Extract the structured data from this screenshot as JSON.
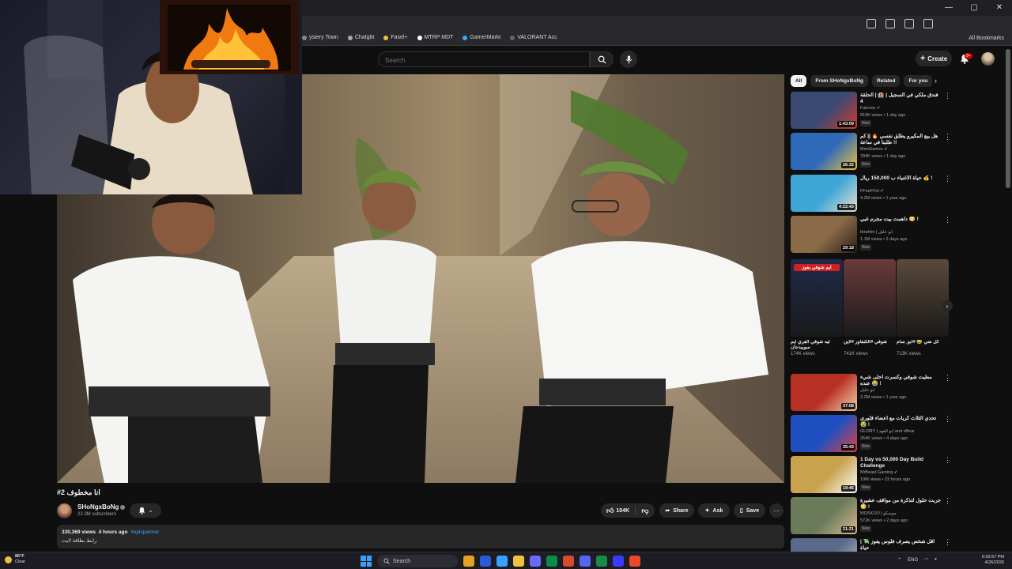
{
  "browser": {
    "window_controls": [
      "—",
      "▢",
      "✕"
    ],
    "bookmarks": [
      {
        "label": "ystery Town",
        "color": "#888888"
      },
      {
        "label": "Chatgbt",
        "color": "#aaaaaa"
      },
      {
        "label": "Fasel+",
        "color": "#f0c040"
      },
      {
        "label": "MTRP MDT",
        "color": "#ffffff"
      },
      {
        "label": "GamerMarkt",
        "color": "#3ea6ff"
      },
      {
        "label": "VALORANT Acc",
        "color": "#666666"
      }
    ],
    "all_bookmarks": "All Bookmarks"
  },
  "header": {
    "search_placeholder": "Search",
    "create_label": "Create",
    "notification_badge": "9+"
  },
  "video": {
    "title": "#2 انا مخطوف",
    "channel": "SHoNgxBoNg",
    "subscribers": "22.3M subscribers",
    "likes": "104K",
    "share_label": "Share",
    "ask_label": "Ask",
    "save_label": "Save",
    "views": "330,369 views",
    "age": "4 hours ago",
    "hashtag": "#epicpartner",
    "desc_line": "رابط بطاقة لايت"
  },
  "sidebar": {
    "chips": [
      "All",
      "From SHoNgxBoNg",
      "Related",
      "For you"
    ],
    "recs": [
      {
        "title": "فندق ملكي في السجيل | 🏨 | الحلقة 4",
        "channel": "Falcons ✔",
        "views": "815K views • 1 day ago",
        "badge": "New",
        "duration": "1:43:09",
        "thumb_color": "#3a4a72",
        "accent": "#d33a2a"
      },
      {
        "title": "هل يبع المكيرو يطلق نفسي 🔥 || كم طلبنا في ساعة !!",
        "channel": "MrmGames ✔",
        "views": "784K views • 1 day ago",
        "badge": "New",
        "duration": "26:32",
        "thumb_color": "#2e6ab8",
        "accent": "#f0c040"
      },
      {
        "title": "حياة الأغنياء ب 150,000 ريال 💰 !",
        "channel": "FFeeFFol ✔",
        "views": "4.2M views • 1 year ago",
        "badge": "",
        "duration": "4:22:43",
        "thumb_color": "#3fa6d8",
        "accent": "#e8e0d0"
      },
      {
        "title": "داهمت بيت مجرم غبي 😳 !",
        "channel": "Ibrahim | ابو خليل",
        "views": "1.1M views • 2 days ago",
        "badge": "New",
        "duration": "29:18",
        "thumb_color": "#8a6a48",
        "accent": "#2a1e16"
      },
      {
        "title": "مطيت شوفي وكسرت احلى شيء عنده 😭 !",
        "channel": "ابو خليل",
        "views": "3.2M views • 1 year ago",
        "badge": "",
        "duration": "37:08",
        "thumb_color": "#b83024",
        "accent": "#f0d0b0"
      },
      {
        "title": "تحدي الثلاث كريات مع اعضاء قلوري 😭 !",
        "channel": "GLORY | أبو الفهد and xBear",
        "views": "264K views • 4 days ago",
        "badge": "New",
        "duration": "35:43",
        "thumb_color": "#2050c0",
        "accent": "#e04040"
      },
      {
        "title": "1 Day vs 50,000 Day Build Challenge",
        "channel": "MrBeast Gaming ✔",
        "views": "10M views • 23 hours ago",
        "badge": "New",
        "duration": "19:46",
        "thumb_color": "#c8a24c",
        "accent": "#ffffff"
      },
      {
        "title": "جربت حلول لتذكرة من مواقف عشيرة 😳 !",
        "channel": "MOSKOO | موسكو",
        "views": "572K views • 2 days ago",
        "badge": "New",
        "duration": "21:21",
        "thumb_color": "#6a7a5a",
        "accent": "#d8b890"
      },
      {
        "title": "اقل شخص يصرف فلوس يفوز 💸 | حياة",
        "channel": "",
        "views": "",
        "badge": "",
        "duration": "",
        "thumb_color": "#5a6a8a",
        "accent": "#c8c8c8"
      }
    ],
    "shorts": [
      {
        "title": "ليه شوفي الفري ايم سوبيدجان",
        "views": "174K views",
        "thumb_color": "#1e2a4a",
        "label": "ايم شوفي يفوز"
      },
      {
        "title": "شوفي #الكنفاور #لاين",
        "views": "741K views",
        "thumb_color": "#6a3a3a",
        "label": ""
      },
      {
        "title": "كل ضي 😂 #ابو_سام",
        "views": "713K views",
        "thumb_color": "#5a4a3a",
        "label": ""
      }
    ]
  },
  "taskbar": {
    "temperature": "86°F",
    "condition": "Clear",
    "search_label": "Search",
    "language": "ENG",
    "time": "6:59:57 PM",
    "date": "4/26/2026",
    "apps": [
      "#e8a020",
      "#2a5ad8",
      "#3aa0ff",
      "#f0c040",
      "#6a6aff",
      "#0c8a4a",
      "#d84a2a",
      "#5865f2",
      "#1a8a4a",
      "#3a3aff",
      "#e84a2a"
    ]
  }
}
